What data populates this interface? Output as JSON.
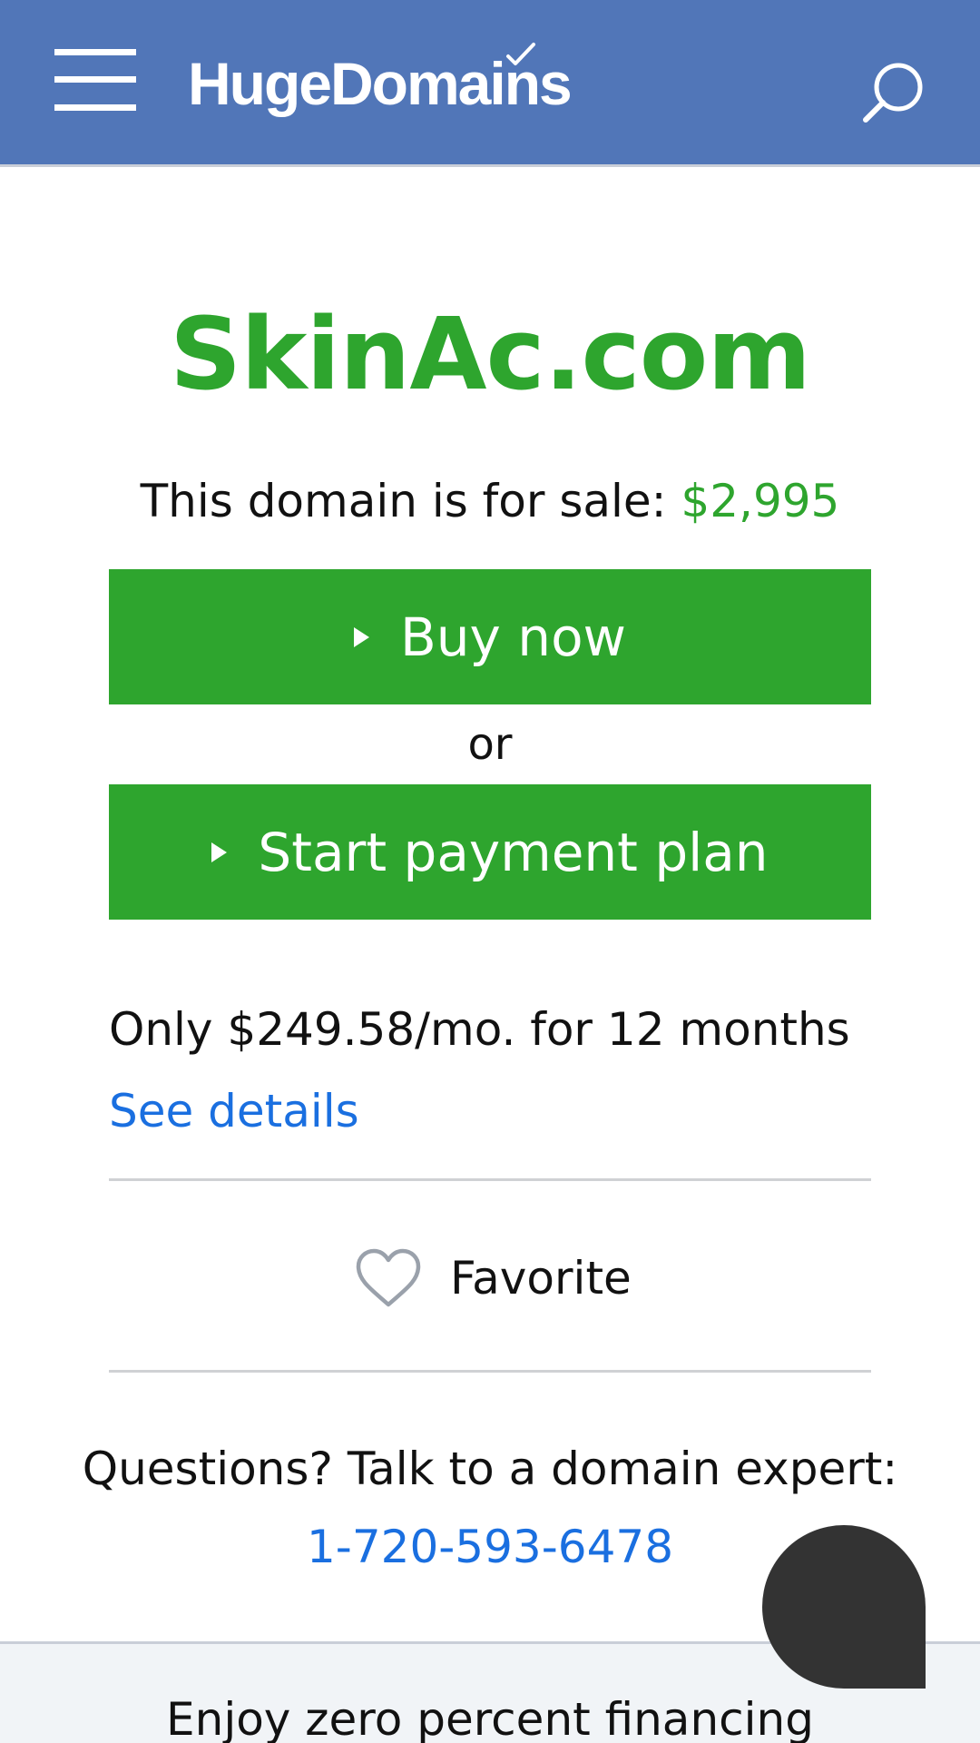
{
  "header": {
    "brand": "HugeDomains",
    "brand_color": "#5176b8",
    "menu_icon": "hamburger-menu-icon",
    "search_icon": "search-icon"
  },
  "domain": {
    "name": "SkinAc.com",
    "sale_text": "This domain is for sale:",
    "price": "$2,995",
    "accent_color": "#2ea52e"
  },
  "actions": {
    "buy_now": "Buy now",
    "or": "or",
    "payment_plan": "Start payment plan"
  },
  "plan": {
    "monthly_text": "Only $249.58/mo. for 12 months",
    "details_link": "See details"
  },
  "favorite": {
    "label": "Favorite",
    "icon": "heart-icon"
  },
  "contact": {
    "prompt": "Questions? Talk to a domain expert:",
    "phone": "1-720-593-6478",
    "link_color": "#1a6fe0"
  },
  "footer": {
    "financing_text": "Enjoy zero percent financing"
  },
  "chat": {
    "icon": "chat-bubble-icon"
  }
}
